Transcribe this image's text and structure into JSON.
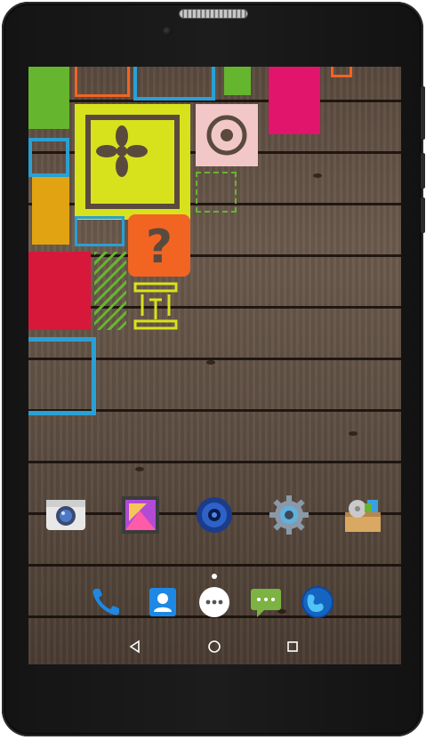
{
  "device": {
    "type": "android-tablet"
  },
  "colors": {
    "wood": "#5e4f43",
    "tile_yellow": "#d8e21c",
    "tile_orange": "#f26422",
    "tile_red": "#d7183a",
    "tile_cyan": "#2aa0d4",
    "tile_green": "#66b52f",
    "tile_pink": "#e0156b",
    "tile_amber": "#e1a312"
  },
  "home_screen": {
    "apps": [
      {
        "icon": "camera-icon"
      },
      {
        "icon": "gallery-icon"
      },
      {
        "icon": "music-icon"
      },
      {
        "icon": "settings-gear-icon"
      },
      {
        "icon": "file-manager-icon"
      }
    ],
    "page_indicator": {
      "pages": 1,
      "current": 1
    }
  },
  "dock": {
    "items": [
      {
        "icon": "phone-icon"
      },
      {
        "icon": "contacts-icon"
      },
      {
        "icon": "app-drawer-icon"
      },
      {
        "icon": "messaging-icon"
      },
      {
        "icon": "browser-globe-icon"
      }
    ]
  },
  "navigation_bar": {
    "buttons": [
      {
        "icon": "back-triangle-icon"
      },
      {
        "icon": "home-circle-icon"
      },
      {
        "icon": "recents-square-icon"
      }
    ]
  }
}
